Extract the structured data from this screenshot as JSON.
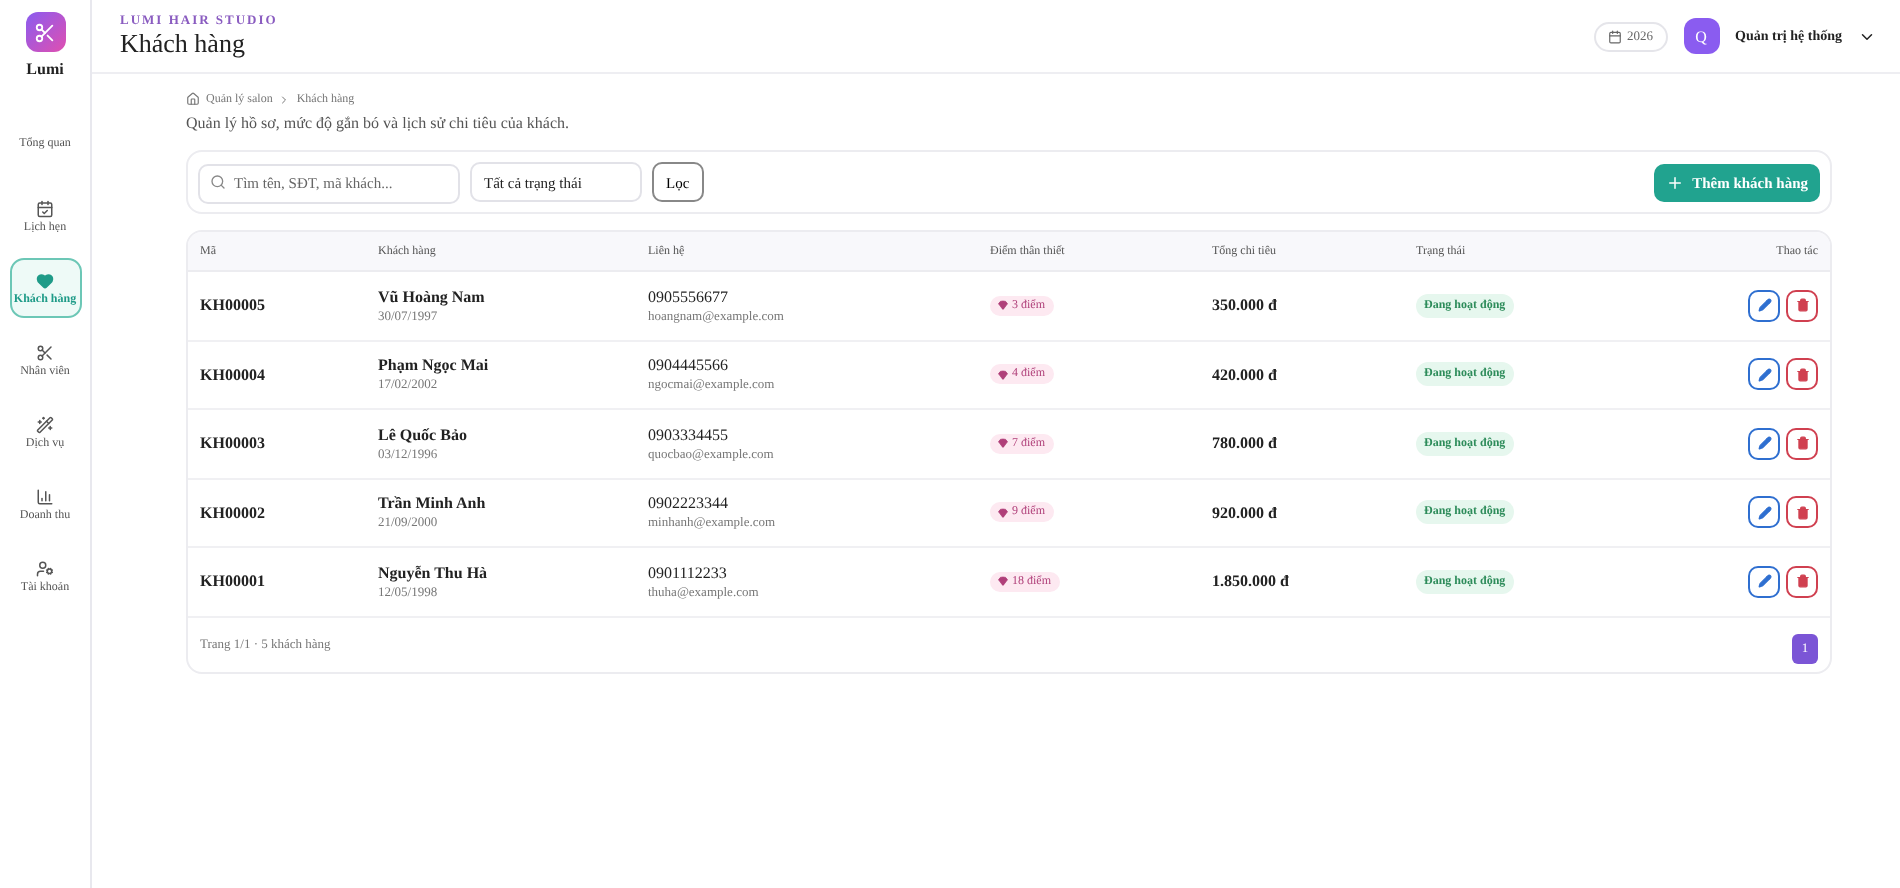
{
  "brand": {
    "name": "Lumi"
  },
  "sidebar": {
    "items": [
      {
        "label": "Tổng quan",
        "selected": false
      },
      {
        "label": "Lịch hẹn",
        "selected": false
      },
      {
        "label": "Khách hàng",
        "selected": true
      },
      {
        "label": "Nhân viên",
        "selected": false
      },
      {
        "label": "Dịch vụ",
        "selected": false
      },
      {
        "label": "Doanh thu",
        "selected": false
      },
      {
        "label": "Tài khoản",
        "selected": false
      }
    ]
  },
  "header": {
    "studio": "LUMI HAIR STUDIO",
    "title": "Khách hàng",
    "date": "2026",
    "user_initial": "Q",
    "user_name": "Quản trị hệ thống"
  },
  "breadcrumb": [
    "Quản lý salon",
    "Khách hàng"
  ],
  "description": "Quản lý hồ sơ, mức độ gắn bó và lịch sử chi tiêu của khách.",
  "filters": {
    "search_placeholder": "Tìm tên, SĐT, mã khách...",
    "status": "Tất cả trạng thái",
    "filter_button": "Lọc",
    "add_button": "Thêm khách hàng"
  },
  "table": {
    "columns": [
      "Mã",
      "Khách hàng",
      "Liên hệ",
      "Điểm thân thiết",
      "Tổng chi tiêu",
      "Trạng thái",
      "Thao tác"
    ],
    "rows": [
      {
        "code": "KH00005",
        "name": "Vũ Hoàng Nam",
        "dob": "30/07/1997",
        "phone": "0905556677",
        "email": "hoangnam@example.com",
        "points": "3 điểm",
        "total": "350.000 đ",
        "status": "Đang hoạt động"
      },
      {
        "code": "KH00004",
        "name": "Phạm Ngọc Mai",
        "dob": "17/02/2002",
        "phone": "0904445566",
        "email": "ngocmai@example.com",
        "points": "4 điểm",
        "total": "420.000 đ",
        "status": "Đang hoạt động"
      },
      {
        "code": "KH00003",
        "name": "Lê Quốc Bảo",
        "dob": "03/12/1996",
        "phone": "0903334455",
        "email": "quocbao@example.com",
        "points": "7 điểm",
        "total": "780.000 đ",
        "status": "Đang hoạt động"
      },
      {
        "code": "KH00002",
        "name": "Trần Minh Anh",
        "dob": "21/09/2000",
        "phone": "0902223344",
        "email": "minhanh@example.com",
        "points": "9 điểm",
        "total": "920.000 đ",
        "status": "Đang hoạt động"
      },
      {
        "code": "KH00001",
        "name": "Nguyễn Thu Hà",
        "dob": "12/05/1998",
        "phone": "0901112233",
        "email": "thuha@example.com",
        "points": "18 điểm",
        "total": "1.850.000 đ",
        "status": "Đang hoạt động"
      }
    ]
  },
  "pagination": {
    "summary": "Trang 1/1 · 5 khách hàng",
    "pages": [
      {
        "label": "1",
        "selected": true
      }
    ]
  }
}
